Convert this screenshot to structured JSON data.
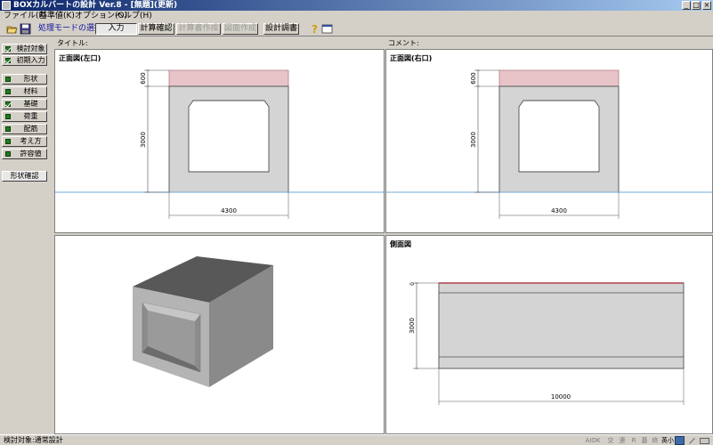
{
  "window": {
    "title": "BOXカルバートの設計 Ver.8 - [無題](更新)",
    "controls": [
      "_",
      "□",
      "×"
    ]
  },
  "menu": [
    "ファイル(F)",
    "基準値(K)",
    "オプション(O)",
    "ヘルプ(H)"
  ],
  "toolbar": {
    "mode_label": "処理モードの選択",
    "buttons": [
      "入力",
      "計算確認",
      "計算書作成",
      "図面作成",
      "設計調書"
    ],
    "disabled": [
      false,
      false,
      true,
      true,
      false
    ]
  },
  "sidebar": {
    "top_items": [
      {
        "label": "検討対象",
        "checked": true
      },
      {
        "label": "初期入力",
        "checked": true
      }
    ],
    "items": [
      {
        "label": "形状",
        "checked": false
      },
      {
        "label": "材料",
        "checked": false
      },
      {
        "label": "基礎",
        "checked": true
      },
      {
        "label": "荷重",
        "checked": false
      },
      {
        "label": "配筋",
        "checked": false
      },
      {
        "label": "考え方",
        "checked": false
      },
      {
        "label": "許容値",
        "checked": false
      }
    ],
    "bottom_button": "形状確認"
  },
  "header": {
    "title_label": "タイトル:",
    "comment_label": "コメント:"
  },
  "panes": {
    "front_left": {
      "title": "正面図(左口)",
      "dim_top": "600",
      "dim_height": "3000",
      "dim_width": "4300"
    },
    "front_right": {
      "title": "正面図(右口)",
      "dim_top": "600",
      "dim_height": "3000",
      "dim_width": "4300"
    },
    "side": {
      "title": "側面図",
      "dim_top": "0",
      "dim_height": "3000",
      "dim_length": "10000"
    }
  },
  "status": {
    "text": "検討対象:通常設計",
    "indicators": [
      "AIOK",
      "交",
      "連",
      "R",
      "基",
      "終",
      "英小"
    ]
  },
  "colors": {
    "soil": "#e8c4c8",
    "concrete": "#d4d4d4",
    "ground_line": "#70a8d8",
    "check_green": "#1e7d1e"
  }
}
